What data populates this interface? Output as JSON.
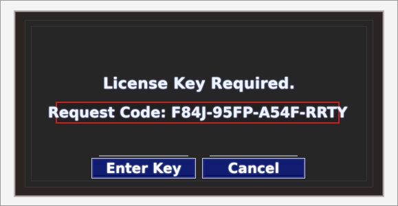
{
  "dialog": {
    "title": "License Key Required.",
    "request_code_text": "Request Code: F84J-95FP-A54F-RRTY"
  },
  "buttons": {
    "enter_key": "Enter Key",
    "cancel": "Cancel"
  },
  "colors": {
    "screen_background": "#262626",
    "request_box_border": "#c9201d",
    "button_fill": "#101d70",
    "text": "#eef4ff"
  }
}
